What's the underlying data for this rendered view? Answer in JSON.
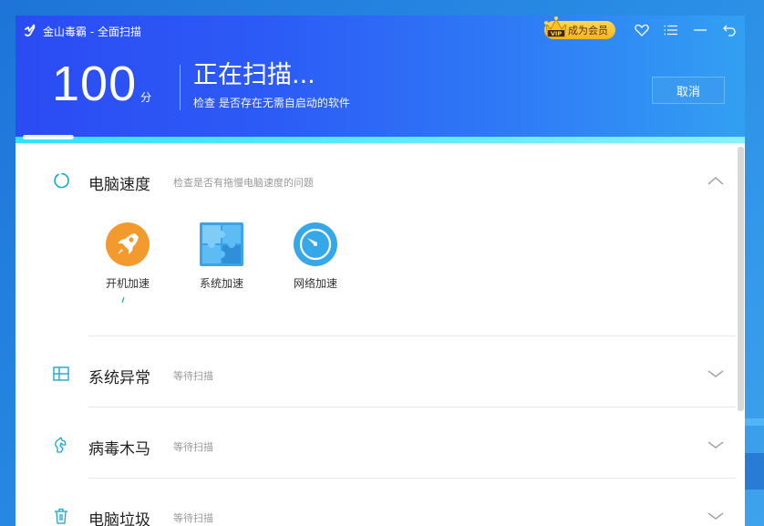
{
  "window": {
    "title": "金山毒霸 - 全面扫描"
  },
  "titlebar": {
    "vip_label": "成为会员",
    "icons": [
      "crown-vip-icon",
      "heart-icon",
      "menu-icon",
      "minimize-icon",
      "back-icon"
    ]
  },
  "header": {
    "score": "100",
    "score_unit": "分",
    "headline": "正在扫描...",
    "subline": "检查 是否存在无需自启动的软件",
    "cancel_label": "取消"
  },
  "sections": [
    {
      "title": "电脑速度",
      "desc": "检查是否有拖慢电脑速度的问题",
      "icon": "loading-circle-icon",
      "expanded": true,
      "items": [
        {
          "label": "开机加速",
          "icon": "rocket-icon",
          "color": "#f39a2f"
        },
        {
          "label": "系统加速",
          "icon": "puzzle-icon",
          "color": "#3ba3e8"
        },
        {
          "label": "网络加速",
          "icon": "compass-icon",
          "color": "#36a7e8"
        }
      ]
    },
    {
      "title": "系统异常",
      "desc": "等待扫描",
      "icon": "windows-icon",
      "expanded": false
    },
    {
      "title": "病毒木马",
      "desc": "等待扫描",
      "icon": "horse-icon",
      "expanded": false
    },
    {
      "title": "电脑垃圾",
      "desc": "等待扫描",
      "icon": "trash-icon",
      "expanded": false
    }
  ],
  "colors": {
    "header_start": "#2b4bf3",
    "header_end": "#32a0f2",
    "accent": "#1aa7c9",
    "scan_line": "#30e3ff"
  }
}
